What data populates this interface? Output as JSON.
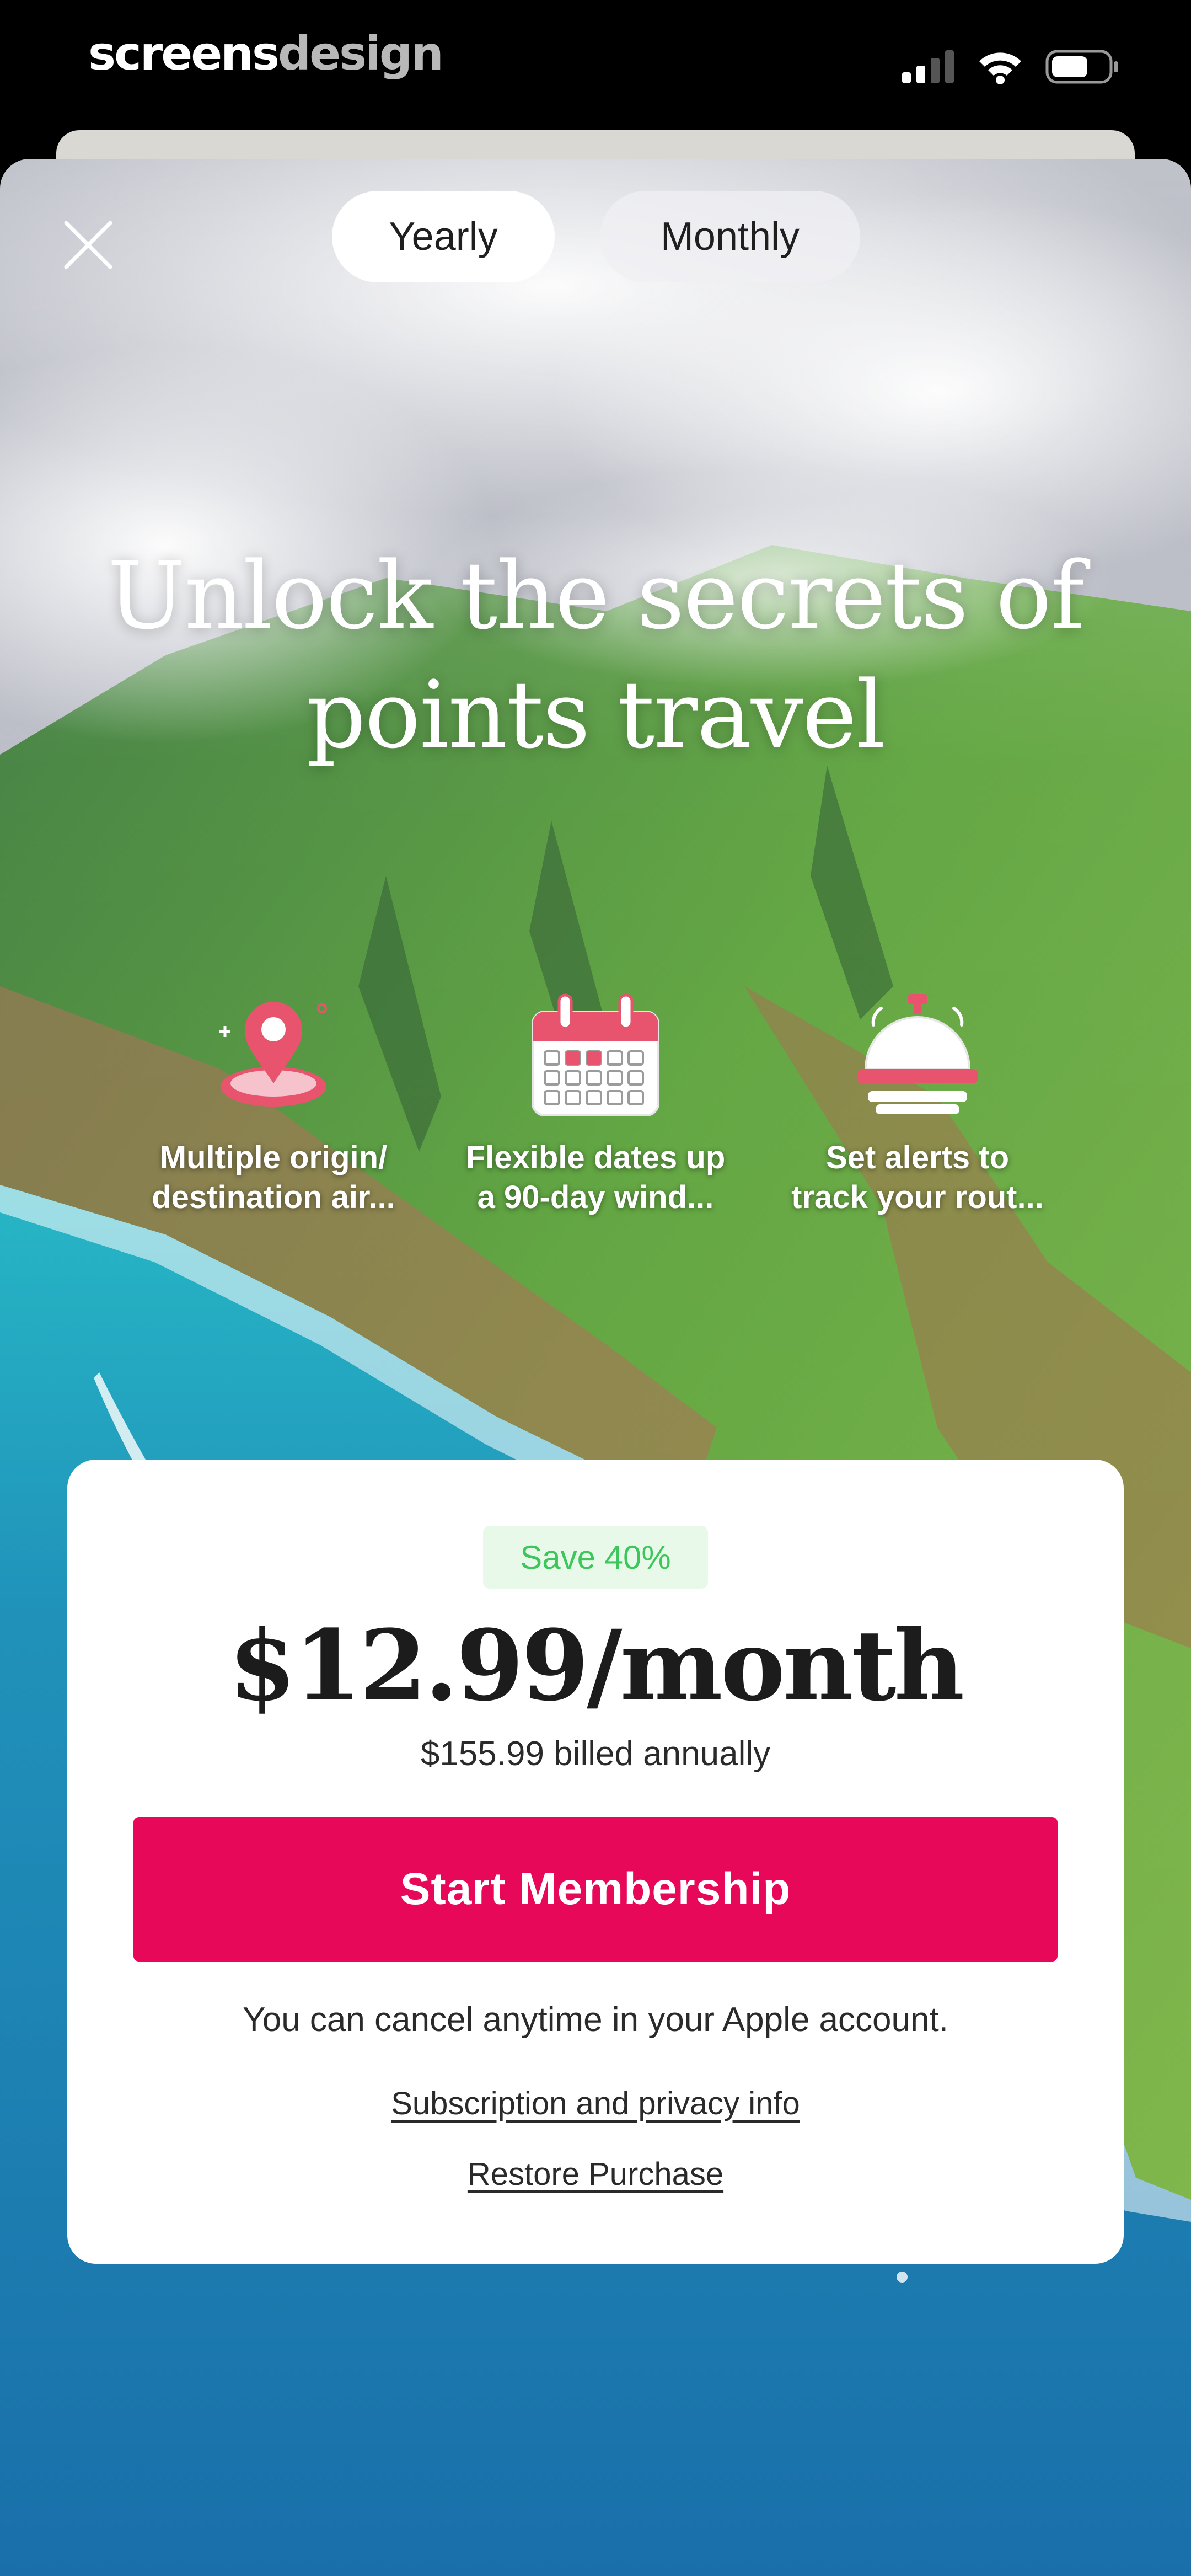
{
  "status_bar": {
    "brand_part1": "screens",
    "brand_part2": "design"
  },
  "plan_toggle": {
    "yearly": "Yearly",
    "monthly": "Monthly",
    "selected": "Yearly"
  },
  "headline": {
    "line1": "Unlock the secrets of",
    "line2": "points travel"
  },
  "features": [
    {
      "icon": "map-pin-icon",
      "line1": "Multiple origin/",
      "line2": "destination air..."
    },
    {
      "icon": "calendar-icon",
      "line1": "Flexible dates up",
      "line2": "a 90-day wind..."
    },
    {
      "icon": "service-bell-icon",
      "line1": "Set alerts to",
      "line2": "track your rout..."
    }
  ],
  "pricing": {
    "badge": "Save 40%",
    "price": "$12.99/month",
    "billed": "$155.99 billed annually",
    "cta": "Start Membership",
    "cancel_note": "You can cancel anytime in your Apple account.",
    "privacy_link": "Subscription and privacy info",
    "restore_link": "Restore Purchase"
  },
  "colors": {
    "accent": "#e8085a",
    "save_green": "#3cc65c",
    "icon_pink": "#e8546e"
  }
}
